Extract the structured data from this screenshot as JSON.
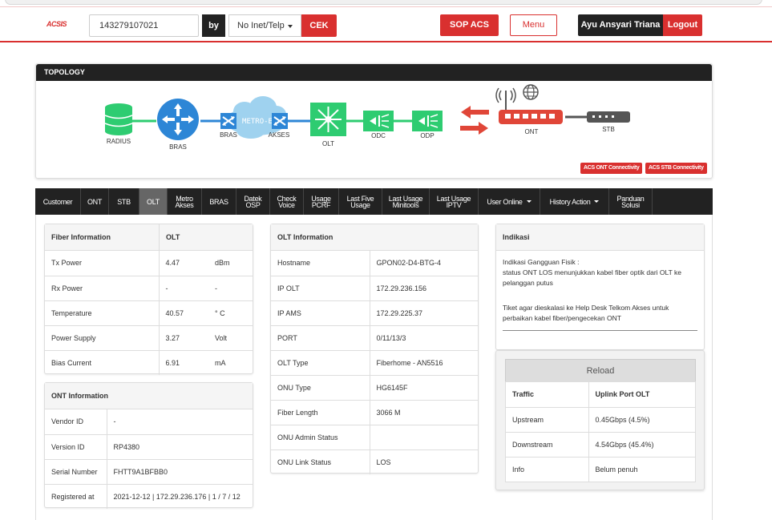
{
  "header": {
    "logo": "ACSIS",
    "search_value": "143279107021",
    "by_label": "by",
    "search_type": "No Inet/Telp",
    "cek_label": "CEK",
    "sop_label": "SOP ACS",
    "menu_label": "Menu",
    "user_name": "Ayu Ansyari Triana",
    "logout_label": "Logout"
  },
  "topology": {
    "title": "TOPOLOGY",
    "nodes": {
      "radius": "RADIUS",
      "bras": "BRAS",
      "bras2": "BRAS",
      "metro": "METRO-E",
      "akses": "AKSES",
      "olt": "OLT",
      "odc": "ODC",
      "odp": "ODP",
      "ont": "ONT",
      "stb": "STB"
    },
    "acs_ont_label": "ACS ONT Connectivity",
    "acs_stb_label": "ACS STB Connectivity",
    "colors": {
      "green": "#2ecc71",
      "blue": "#2d86d6",
      "red": "#e04638",
      "gray": "#555555"
    }
  },
  "tabs": [
    {
      "line1": "Customer",
      "line2": ""
    },
    {
      "line1": "ONT",
      "line2": ""
    },
    {
      "line1": "STB",
      "line2": ""
    },
    {
      "line1": "OLT",
      "line2": ""
    },
    {
      "line1": "Metro",
      "line2": "Akses"
    },
    {
      "line1": "BRAS",
      "line2": ""
    },
    {
      "line1": "Datek",
      "line2": "OSP"
    },
    {
      "line1": "Check",
      "line2": "Voice"
    },
    {
      "line1": "Usage",
      "line2": "PCRF"
    },
    {
      "line1": "Last Five",
      "line2": "Usage"
    },
    {
      "line1": "Last Usage",
      "line2": "Minitools"
    },
    {
      "line1": "Last Usage",
      "line2": "IPTV"
    },
    {
      "line1": "User Online",
      "line2": ""
    },
    {
      "line1": "History Action",
      "line2": ""
    },
    {
      "line1": "Panduan",
      "line2": "Solusi"
    }
  ],
  "fiber_info": {
    "title": "Fiber Information",
    "col_title": "OLT",
    "rows": [
      {
        "label": "Tx Power",
        "value": "4.47",
        "unit": "dBm"
      },
      {
        "label": "Rx Power",
        "value": "-",
        "unit": "-"
      },
      {
        "label": "Temperature",
        "value": "40.57",
        "unit": "° C"
      },
      {
        "label": "Power Supply",
        "value": "3.27",
        "unit": "Volt"
      },
      {
        "label": "Bias Current",
        "value": "6.91",
        "unit": "mA"
      }
    ]
  },
  "ont_info": {
    "title": "ONT Information",
    "rows": [
      {
        "label": "Vendor ID",
        "value": "-"
      },
      {
        "label": "Version ID",
        "value": "RP4380"
      },
      {
        "label": "Serial Number",
        "value": "FHTT9A1BFBB0"
      },
      {
        "label": "Registered at",
        "value": "2021-12-12 | 172.29.236.176 | 1 / 7 / 12"
      }
    ]
  },
  "olt_info": {
    "title": "OLT Information",
    "rows": [
      {
        "label": "Hostname",
        "value": "GPON02-D4-BTG-4"
      },
      {
        "label": "IP OLT",
        "value": "172.29.236.156"
      },
      {
        "label": "IP AMS",
        "value": "172.29.225.37"
      },
      {
        "label": "PORT",
        "value": "0/11/13/3"
      },
      {
        "label": "OLT Type",
        "value": "Fiberhome - AN5516"
      },
      {
        "label": "ONU Type",
        "value": "HG6145F"
      },
      {
        "label": "Fiber Length",
        "value": "3066 M"
      },
      {
        "label": "ONU Admin Status",
        "value": ""
      },
      {
        "label": "ONU Link Status",
        "value": "LOS"
      }
    ]
  },
  "indikasi": {
    "title": "Indikasi",
    "line1": "Indikasi Gangguan Fisik :",
    "line2": "status ONT LOS menunjukkan kabel fiber optik dari OLT ke pelanggan putus",
    "line3": "Tiket agar dieskalasi ke Help Desk Telkom Akses untuk perbaikan kabel fiber/pengecekan ONT"
  },
  "traffic": {
    "reload_label": "Reload",
    "header": {
      "label": "Traffic",
      "value": "Uplink Port OLT"
    },
    "rows": [
      {
        "label": "Upstream",
        "value": "0.45Gbps (4.5%)"
      },
      {
        "label": "Downstream",
        "value": "4.54Gbps (45.4%)"
      },
      {
        "label": "Info",
        "value": "Belum penuh"
      }
    ]
  }
}
